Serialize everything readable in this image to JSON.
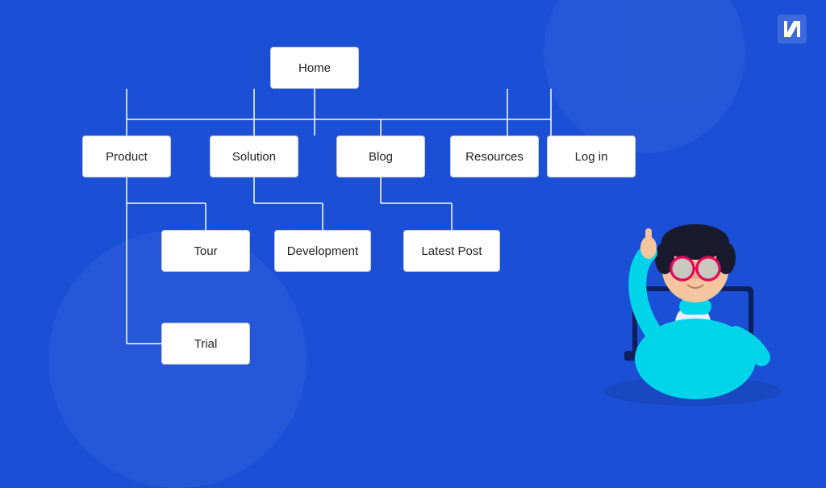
{
  "logo": {
    "label": "N",
    "icon": "logo-icon"
  },
  "tree": {
    "nodes": {
      "home": {
        "label": "Home"
      },
      "product": {
        "label": "Product"
      },
      "solution": {
        "label": "Solution"
      },
      "blog": {
        "label": "Blog"
      },
      "resources": {
        "label": "Resources"
      },
      "login": {
        "label": "Log in"
      },
      "tour": {
        "label": "Tour"
      },
      "development": {
        "label": "Development"
      },
      "latest": {
        "label": "Latest Post"
      },
      "trial": {
        "label": "Trial"
      }
    }
  }
}
